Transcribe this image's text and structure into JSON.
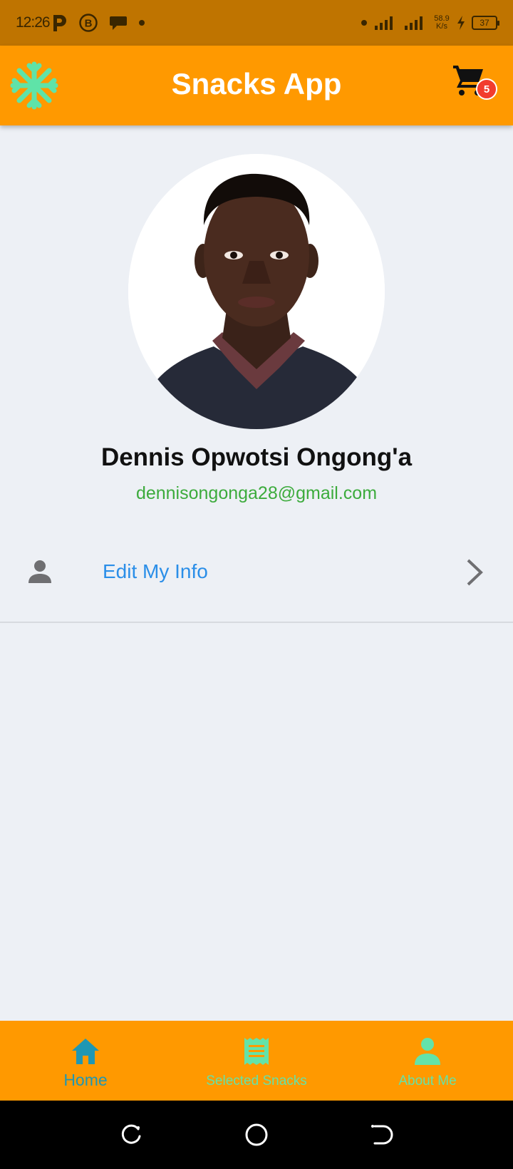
{
  "status_bar": {
    "time": "12:26",
    "left_icons": [
      "parking-icon",
      "b-circle-icon",
      "chat-bubble-icon",
      "dot-icon"
    ],
    "net_speed_value": "58.9",
    "net_speed_unit": "K/s",
    "battery": "37"
  },
  "app_bar": {
    "title": "Snacks App",
    "logo_icon": "snowflake-icon",
    "cart_icon": "shopping-cart-icon",
    "cart_count": "5"
  },
  "profile": {
    "name": "Dennis Opwotsi Ongong'a",
    "email": "dennisongonga28@gmail.com"
  },
  "menu": {
    "items": [
      {
        "label": "Edit My Info",
        "icon": "person-icon",
        "trailing_icon": "chevron-right-icon"
      }
    ]
  },
  "bottom_nav": {
    "items": [
      {
        "label": "Home",
        "icon": "home-icon",
        "active": true
      },
      {
        "label": "Selected Snacks",
        "icon": "receipt-list-icon",
        "active": false
      },
      {
        "label": "About Me",
        "icon": "person-icon",
        "active": false
      }
    ]
  },
  "colors": {
    "status_bar": "#bf7400",
    "app_bar": "#ff9900",
    "background": "#edf0f5",
    "accent_blue": "#2a8ee8",
    "email_green": "#3cab3c",
    "nav_active": "#1f97b3",
    "nav_inactive": "#63e3a9",
    "badge_red": "#f23c2e"
  }
}
